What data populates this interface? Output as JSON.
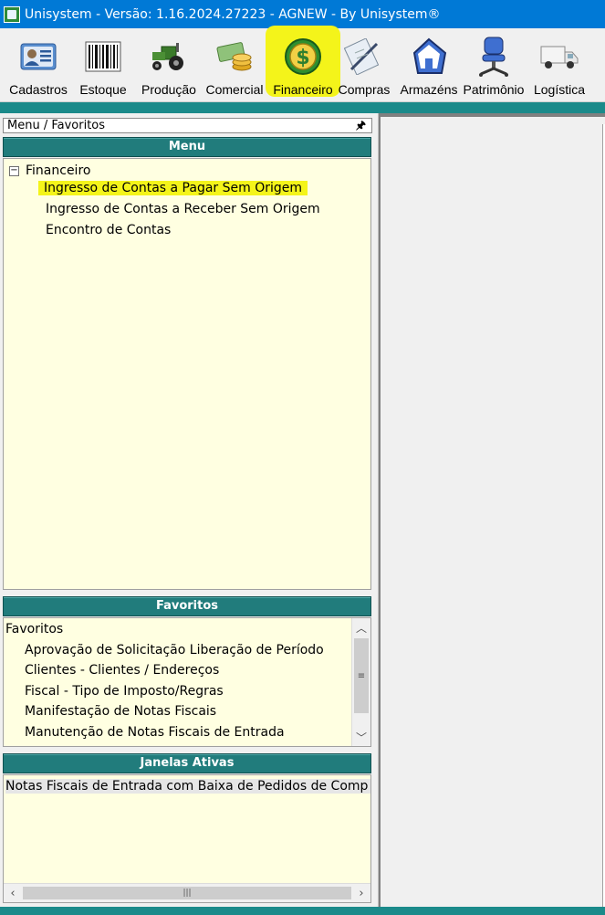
{
  "window": {
    "title": "Unisystem - Versão: 1.16.2024.27223 - AGNEW - By Unisystem®"
  },
  "toolbar": {
    "items": [
      {
        "label": "Cadastros"
      },
      {
        "label": "Estoque"
      },
      {
        "label": "Produção"
      },
      {
        "label": "Comercial"
      },
      {
        "label": "Financeiro",
        "active": true
      },
      {
        "label": "Compras"
      },
      {
        "label": "Armazéns"
      },
      {
        "label": "Patrimônio"
      },
      {
        "label": "Logística"
      }
    ]
  },
  "panel": {
    "caption": "Menu / Favoritos",
    "pin_glyph": "🖈"
  },
  "menu": {
    "header": "Menu",
    "root": "Financeiro",
    "toggle": "−",
    "items": [
      "Ingresso de Contas a Pagar Sem Origem",
      "Ingresso de Contas a Receber Sem Origem",
      "Encontro de Contas"
    ]
  },
  "favorites": {
    "header": "Favoritos",
    "root": "Favoritos",
    "items": [
      "Aprovação de Solicitação Liberação de Período",
      "Clientes - Clientes / Endereços",
      "Fiscal - Tipo de Imposto/Regras",
      "Manifestação de Notas Fiscais",
      "Manutenção de Notas Fiscais de Entrada"
    ]
  },
  "active_windows": {
    "header": "Janelas Ativas",
    "items": [
      "Notas Fiscais de Entrada com Baixa de Pedidos de Comp"
    ]
  },
  "colors": {
    "highlight": "#f4f41a",
    "teal": "#217c7c",
    "panel_bg": "#ffffe1",
    "titlebar": "#0079d6"
  }
}
